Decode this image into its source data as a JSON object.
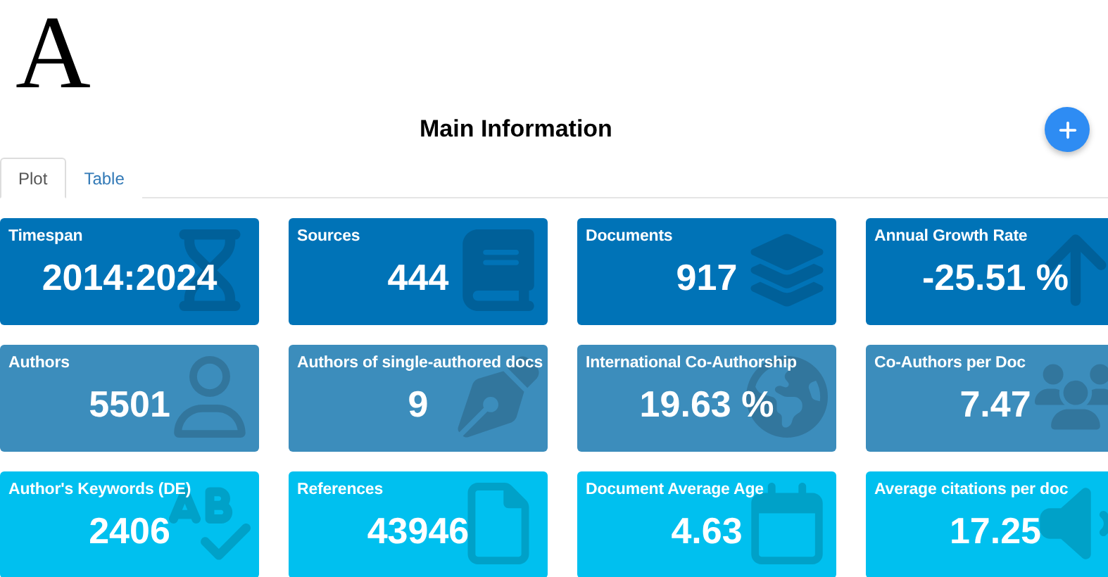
{
  "logo": "A",
  "title": "Main Information",
  "tabs": [
    {
      "label": "Plot",
      "selected": true
    },
    {
      "label": "Table",
      "selected": false
    }
  ],
  "cards": [
    {
      "label": "Timespan",
      "value": "2014:2024",
      "color": "#0073b7"
    },
    {
      "label": "Sources",
      "value": "444",
      "color": "#0073b7"
    },
    {
      "label": "Documents",
      "value": "917",
      "color": "#0073b7"
    },
    {
      "label": "Annual Growth Rate",
      "value": "-25.51 %",
      "color": "#0073b7"
    },
    {
      "label": "Authors",
      "value": "5501",
      "color": "#3c8dbc"
    },
    {
      "label": "Authors of single-authored docs",
      "value": "9",
      "color": "#3c8dbc"
    },
    {
      "label": "International Co-Authorship",
      "value": "19.63 %",
      "color": "#3c8dbc"
    },
    {
      "label": "Co-Authors per Doc",
      "value": "7.47",
      "color": "#3c8dbc"
    },
    {
      "label": "Author's Keywords (DE)",
      "value": "2406",
      "color": "#00c0ef"
    },
    {
      "label": "References",
      "value": "43946",
      "color": "#00c0ef"
    },
    {
      "label": "Document Average Age",
      "value": "4.63",
      "color": "#00c0ef"
    },
    {
      "label": "Average citations per doc",
      "value": "17.25",
      "color": "#00c0ef"
    }
  ]
}
